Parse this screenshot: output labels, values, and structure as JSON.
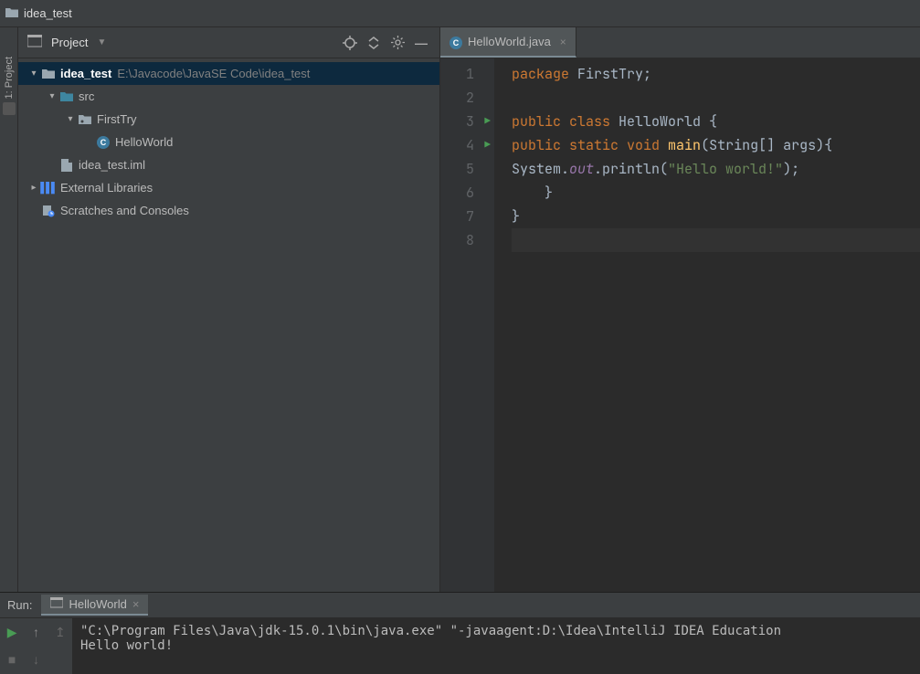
{
  "titlebar": {
    "title": "idea_test"
  },
  "sidebar_rail": {
    "project_label": "1: Project"
  },
  "project_panel": {
    "header_label": "Project",
    "nodes": {
      "root": {
        "label": "idea_test",
        "path": "E:\\Javacode\\JavaSE Code\\idea_test"
      },
      "src": {
        "label": "src"
      },
      "pkg": {
        "label": "FirstTry"
      },
      "cls": {
        "label": "HelloWorld"
      },
      "iml": {
        "label": "idea_test.iml"
      },
      "ext": {
        "label": "External Libraries"
      },
      "scratch": {
        "label": "Scratches and Consoles"
      }
    }
  },
  "editor": {
    "tab_label": "HelloWorld.java",
    "lines": {
      "l1": {
        "num": "1"
      },
      "l2": {
        "num": "2"
      },
      "l3": {
        "num": "3"
      },
      "l4": {
        "num": "4"
      },
      "l5": {
        "num": "5"
      },
      "l6": {
        "num": "6"
      },
      "l7": {
        "num": "7"
      },
      "l8": {
        "num": "8"
      }
    },
    "code": {
      "package_kw": "package",
      "package_name": " FirstTry",
      "semi": ";",
      "public_kw": "public",
      "class_kw": " class",
      "class_name": " HelloWorld ",
      "brace_o": "{",
      "static_kw": " static",
      "void_kw": " void",
      "main_fn": " main",
      "main_args": "(String[] args){",
      "system": "System.",
      "out_field": "out",
      "println": ".println(",
      "hello_str": "\"Hello world!\"",
      "close_call": ");",
      "brace_c_inner": "    }",
      "brace_c_outer": "}"
    }
  },
  "run": {
    "label": "Run:",
    "config_name": "HelloWorld",
    "console_line1": "\"C:\\Program Files\\Java\\jdk-15.0.1\\bin\\java.exe\" \"-javaagent:D:\\Idea\\IntelliJ IDEA Education",
    "console_line2": "Hello world!"
  }
}
